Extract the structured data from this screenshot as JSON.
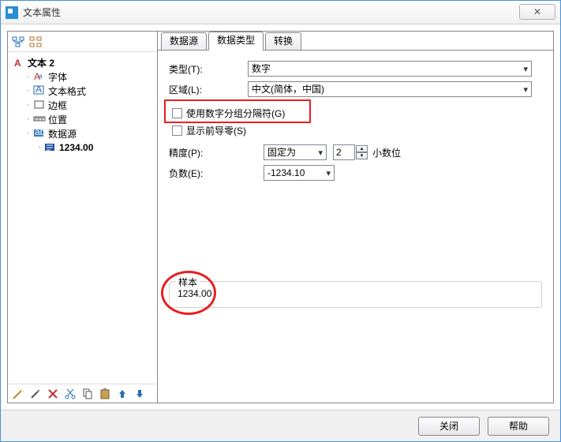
{
  "window": {
    "title": "文本属性",
    "close_glyph": "✕"
  },
  "sidebar": {
    "root_label": "文本 2",
    "items": [
      {
        "label": "字体"
      },
      {
        "label": "文本格式"
      },
      {
        "label": "边框"
      },
      {
        "label": "位置"
      },
      {
        "label": "数据源",
        "children": [
          {
            "label": "1234.00"
          }
        ]
      }
    ]
  },
  "tabs": {
    "t0": "数据源",
    "t1": "数据类型",
    "t2": "转换"
  },
  "form": {
    "type_label": "类型(T):",
    "type_value": "数字",
    "region_label": "区域(L):",
    "region_value": "中文(简体，中国)",
    "grouping_label": "使用数字分组分隔符(G)",
    "leadingzero_label": "显示前导零(S)",
    "precision_label": "精度(P):",
    "precision_mode": "固定为",
    "precision_value": "2",
    "precision_suffix": "小数位",
    "negative_label": "负数(E):",
    "negative_value": "-1234.10"
  },
  "sample": {
    "legend": "样本",
    "value": "1234.00"
  },
  "footer": {
    "close": "关闭",
    "help": "帮助"
  }
}
